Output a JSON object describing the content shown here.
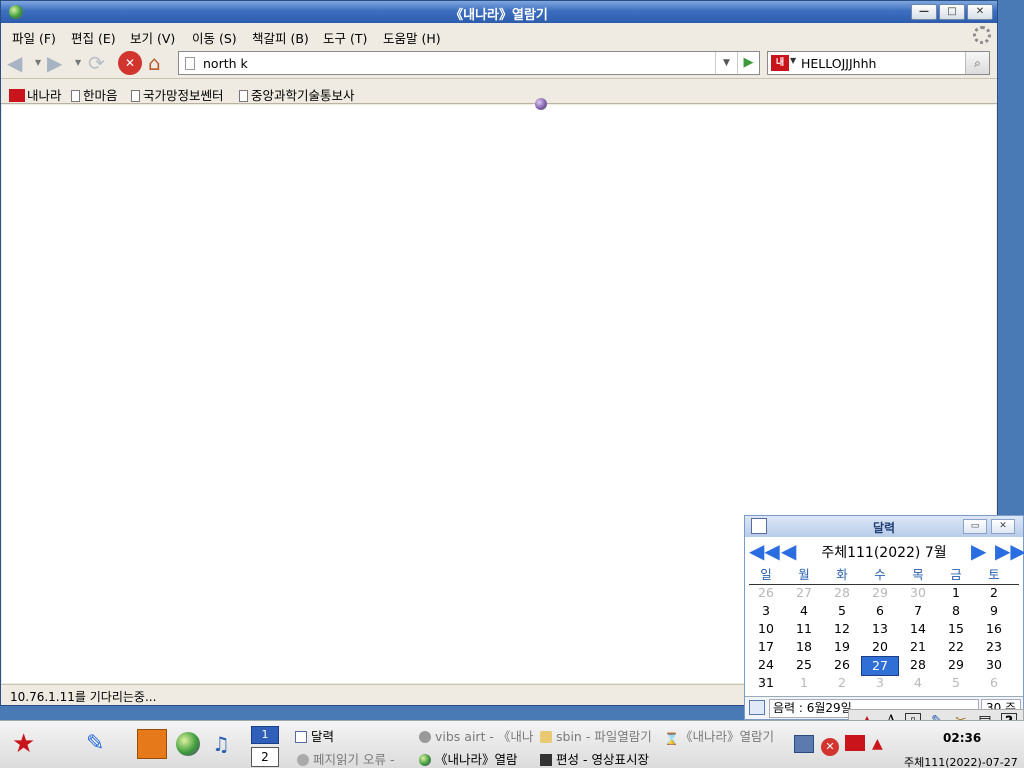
{
  "window": {
    "title": "《내나라》열람기",
    "minimize": "—",
    "maximize": "□",
    "close": "✕"
  },
  "menu": [
    "파일 (F)",
    "편집 (E)",
    "보기 (V)",
    "이동 (S)",
    "책갈피 (B)",
    "도구 (T)",
    "도움말 (H)"
  ],
  "nav": {
    "url_value": "north k",
    "search_value": "HELLOJJJhhh",
    "search_engine_icon": "naenara-logo-icon"
  },
  "bookmarks": [
    "내나라",
    "한마음",
    "국가망정보쎈터",
    "중앙과학기술통보사"
  ],
  "status": "10.76.1.11를 기다리는중...",
  "calendar": {
    "title": "달력",
    "month_label": "주체111(2022)  7월",
    "weekdays": [
      "일",
      "월",
      "화",
      "수",
      "목",
      "금",
      "토"
    ],
    "weeks": [
      [
        "26",
        "27",
        "28",
        "29",
        "30",
        "1",
        "2"
      ],
      [
        "3",
        "4",
        "5",
        "6",
        "7",
        "8",
        "9"
      ],
      [
        "10",
        "11",
        "12",
        "13",
        "14",
        "15",
        "16"
      ],
      [
        "17",
        "18",
        "19",
        "20",
        "21",
        "22",
        "23"
      ],
      [
        "24",
        "25",
        "26",
        "27",
        "28",
        "29",
        "30"
      ],
      [
        "31",
        "1",
        "2",
        "3",
        "4",
        "5",
        "6"
      ]
    ],
    "today": "27",
    "lunar_label": "음력 : 6월29일",
    "zoom": "30 주"
  },
  "taskbar": {
    "desktop1": "1",
    "desktop2": "2",
    "tasks": [
      {
        "label": "달력",
        "active": true
      },
      {
        "label": "vibs airt - 《내나",
        "active": false
      },
      {
        "label": "sbin - 파일열람기",
        "active": false
      },
      {
        "label": "《내나라》열람기",
        "active": false
      },
      {
        "label": "페지읽기 오류 -",
        "active": false
      },
      {
        "label": "《내나라》열람",
        "active": true
      },
      {
        "label": "편성 - 영상표시장",
        "active": true
      }
    ],
    "clock": "02:36",
    "date": "주체111(2022)-07-27"
  },
  "colors": {
    "titlebar": "#3d6fc0",
    "accent_blue": "#2f6fd6",
    "brand_red": "#c9141b"
  }
}
